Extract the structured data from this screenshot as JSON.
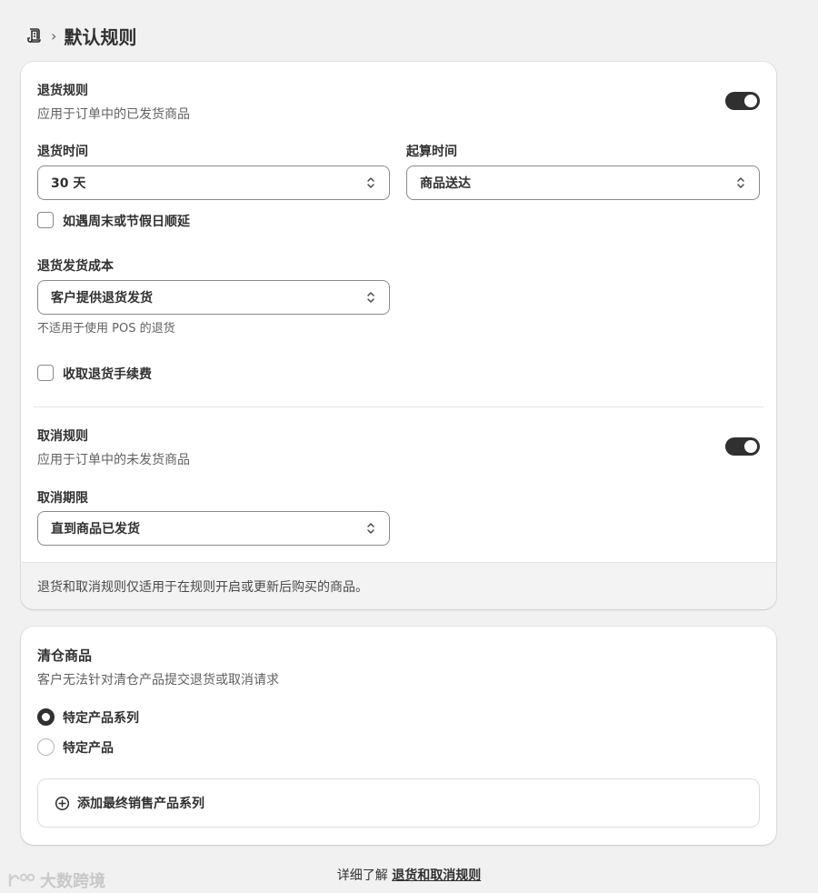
{
  "header": {
    "breadcrumb_icon": "policy-icon",
    "separator": "›",
    "title": "默认规则"
  },
  "returns": {
    "title": "退货规则",
    "subtitle": "应用于订单中的已发货商品",
    "enabled": true,
    "window_label": "退货时间",
    "window_value": "30 天",
    "start_label": "起算时间",
    "start_value": "商品送达",
    "extend_checkbox_label": "如遇周末或节假日顺延",
    "shipping_cost_label": "退货发货成本",
    "shipping_cost_value": "客户提供退货发货",
    "shipping_cost_help": "不适用于使用 POS 的退货",
    "fee_checkbox_label": "收取退货手续费"
  },
  "cancel": {
    "title": "取消规则",
    "subtitle": "应用于订单中的未发货商品",
    "enabled": true,
    "deadline_label": "取消期限",
    "deadline_value": "直到商品已发货"
  },
  "card_footer_note": "退货和取消规则仅适用于在规则开启或更新后购买的商品。",
  "final_sale": {
    "title": "清仓商品",
    "subtitle": "客户无法针对清仓产品提交退货或取消请求",
    "options": [
      {
        "label": "特定产品系列",
        "selected": true
      },
      {
        "label": "特定产品",
        "selected": false
      }
    ],
    "add_button_label": "添加最终销售产品系列",
    "add_icon": "plus-circle-icon"
  },
  "learn_more": {
    "prefix": "详细了解",
    "link": "退货和取消规则"
  },
  "watermark": {
    "text": "大数跨境"
  },
  "colors": {
    "background": "#f1f1f1",
    "card": "#ffffff",
    "toggle_on": "#303030",
    "text": "#303030",
    "subdued": "#616161"
  }
}
